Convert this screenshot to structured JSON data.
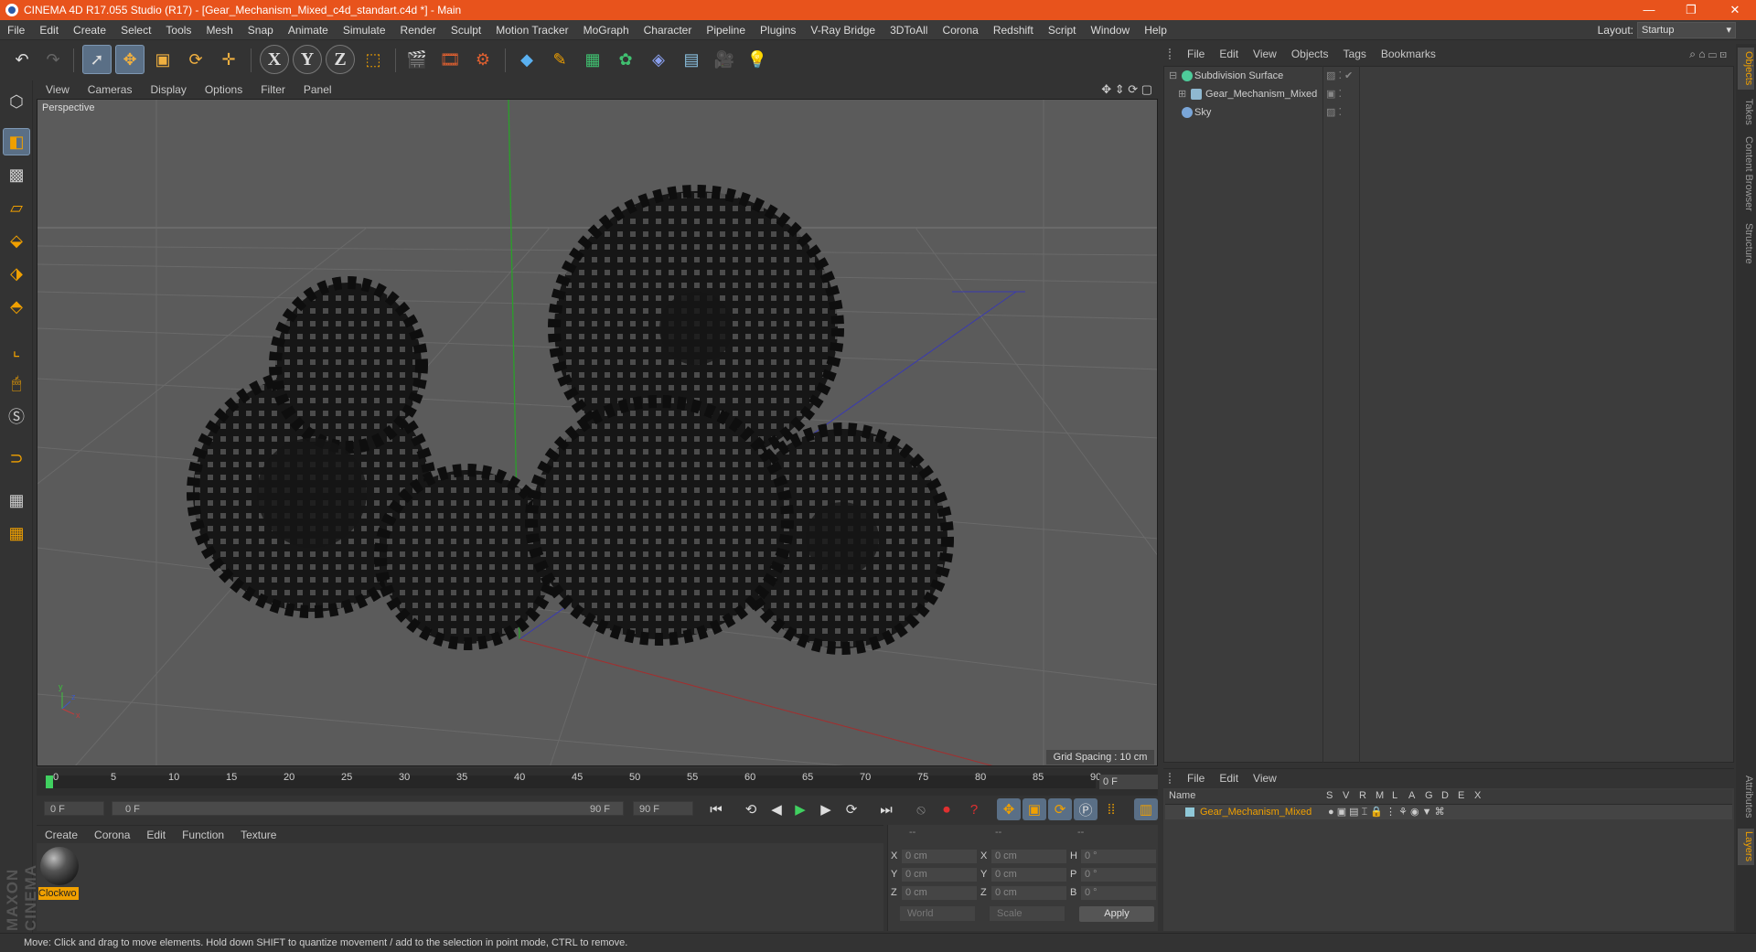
{
  "window": {
    "title": "CINEMA 4D R17.055 Studio (R17) - [Gear_Mechanism_Mixed_c4d_standart.c4d *] - Main",
    "minimize": "—",
    "restore": "❐",
    "close": "✕"
  },
  "menubar": [
    "File",
    "Edit",
    "Create",
    "Select",
    "Tools",
    "Mesh",
    "Snap",
    "Animate",
    "Simulate",
    "Render",
    "Sculpt",
    "Motion Tracker",
    "MoGraph",
    "Character",
    "Pipeline",
    "Plugins",
    "V-Ray Bridge",
    "3DToAll",
    "Corona",
    "Redshift",
    "Script",
    "Window",
    "Help"
  ],
  "layout": {
    "label": "Layout:",
    "value": "Startup"
  },
  "viewport": {
    "menu": [
      "View",
      "Cameras",
      "Display",
      "Options",
      "Filter",
      "Panel"
    ],
    "label": "Perspective",
    "grid_spacing": "Grid Spacing : 10 cm"
  },
  "timeline": {
    "ticks": [
      "0",
      "5",
      "10",
      "15",
      "20",
      "25",
      "30",
      "35",
      "40",
      "45",
      "50",
      "55",
      "60",
      "65",
      "70",
      "75",
      "80",
      "85",
      "90"
    ],
    "current_frame": "0 F",
    "start": "0 F",
    "range_start": "0 F",
    "range_end": "90 F",
    "end": "90 F"
  },
  "material_manager": {
    "menu": [
      "Create",
      "Corona",
      "Edit",
      "Function",
      "Texture"
    ],
    "materials": [
      {
        "name": "Clockwo"
      }
    ]
  },
  "coordinates": {
    "header": [
      "--",
      "--",
      "--"
    ],
    "pos_labels": [
      "X",
      "Y",
      "Z"
    ],
    "pos_values": [
      "0 cm",
      "0 cm",
      "0 cm"
    ],
    "size_labels": [
      "X",
      "Y",
      "Z"
    ],
    "size_values": [
      "0 cm",
      "0 cm",
      "0 cm"
    ],
    "rot_labels": [
      "H",
      "P",
      "B"
    ],
    "rot_values": [
      "0 °",
      "0 °",
      "0 °"
    ],
    "mode1": "World",
    "mode2": "Scale",
    "apply": "Apply"
  },
  "object_manager": {
    "menu": [
      "File",
      "Edit",
      "View",
      "Objects",
      "Tags",
      "Bookmarks"
    ],
    "objects": [
      {
        "name": "Subdivision Surface",
        "color": "#4ecb9a"
      },
      {
        "name": "Gear_Mechanism_Mixed",
        "color": "#8fb8d0"
      },
      {
        "name": "Sky",
        "color": "#7aa6d8"
      }
    ]
  },
  "layer_manager": {
    "menu": [
      "File",
      "Edit",
      "View"
    ],
    "columns": [
      "Name",
      "S",
      "V",
      "R",
      "M",
      "L",
      "A",
      "G",
      "D",
      "E",
      "X"
    ],
    "layers": [
      {
        "name": "Gear_Mechanism_Mixed",
        "color": "#8fc8d8"
      }
    ]
  },
  "side_tabs": [
    "Objects",
    "Takes",
    "Content Browser",
    "Structure",
    "Attributes",
    "Layers"
  ],
  "status": "Move: Click and drag to move elements. Hold down SHIFT to quantize movement / add to the selection in point mode, CTRL to remove.",
  "brand": "MAXON CINEMA 4D",
  "colors": {
    "titlebar": "#e8531c",
    "accent": "#f0a000",
    "viewport_bg": "#5b5b5b"
  }
}
